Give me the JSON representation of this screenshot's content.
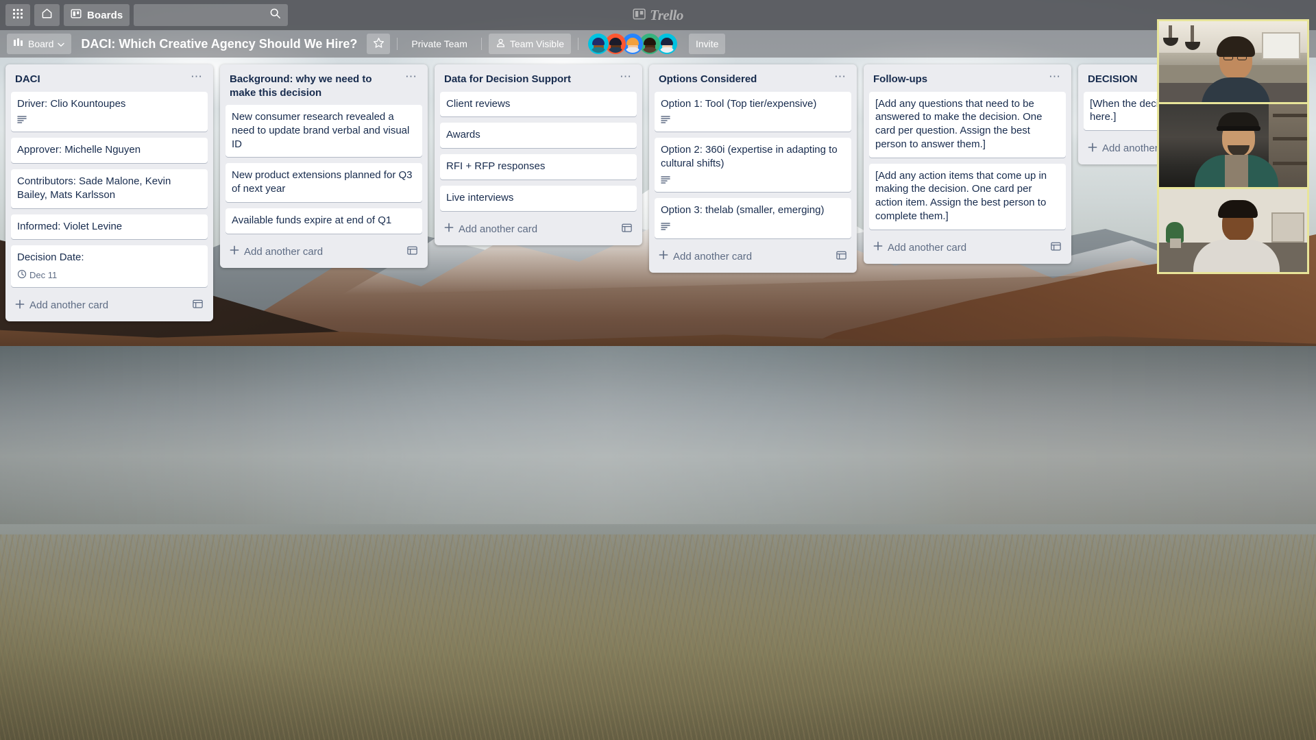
{
  "topbar": {
    "apps_icon": "grid-apps-icon",
    "home_icon": "home-icon",
    "boards_label": "Boards",
    "boards_icon": "board-icon",
    "search_placeholder": "",
    "search_value": "",
    "search_icon": "search-icon",
    "logo_text": "Trello"
  },
  "boardbar": {
    "board_button_label": "Board",
    "board_button_icon": "board-switch-icon",
    "chevron_icon": "chevron-down-icon",
    "title": "DACI: Which Creative Agency Should We Hire?",
    "star_icon": "star-icon",
    "team_label": "Private Team",
    "visibility_label": "Team Visible",
    "visibility_icon": "person-icon",
    "invite_label": "Invite",
    "members": [
      {
        "name": "member-1",
        "ring": "#00c2e0",
        "skin": "#8d5524",
        "hair": "#1f2b6b",
        "body": "#1f7a8c"
      },
      {
        "name": "member-2",
        "ring": "#ff5630",
        "skin": "#5a3318",
        "hair": "#1b1b2a",
        "body": "#243b53"
      },
      {
        "name": "member-3",
        "ring": "#2684ff",
        "skin": "#f3c9a0",
        "hair": "#f2a03d",
        "body": "#e8e8ec"
      },
      {
        "name": "member-4",
        "ring": "#36b37e",
        "skin": "#4b2a14",
        "hair": "#21150c",
        "body": "#5a4030"
      },
      {
        "name": "member-5",
        "ring": "#00c2e0",
        "skin": "#f0cdb0",
        "hair": "#1c2340",
        "body": "#eceff3"
      }
    ]
  },
  "lists": [
    {
      "title": "DACI",
      "menu_icon": "list-menu-icon",
      "add_card_label": "Add another card",
      "add_card_plus_icon": "plus-icon",
      "template_icon": "card-template-icon",
      "cards": [
        {
          "title": "Driver: Clio Kountoupes",
          "description_icon": "description-icon",
          "has_description": true
        },
        {
          "title": "Approver: Michelle Nguyen",
          "has_description": false
        },
        {
          "title": "Contributors: Sade Malone, Kevin Bailey, Mats Karlsson",
          "has_description": false
        },
        {
          "title": "Informed: Violet Levine",
          "has_description": false
        },
        {
          "title": "Decision Date:",
          "has_description": false,
          "due_badge": "Dec 11",
          "due_icon": "clock-icon"
        }
      ]
    },
    {
      "title": "Background: why we need to make this decision",
      "menu_icon": "list-menu-icon",
      "add_card_label": "Add another card",
      "add_card_plus_icon": "plus-icon",
      "template_icon": "card-template-icon",
      "cards": [
        {
          "title": "New consumer research revealed a need to update brand verbal and visual ID",
          "has_description": false
        },
        {
          "title": "New product extensions planned for Q3 of next year",
          "has_description": false
        },
        {
          "title": "Available funds expire at end of Q1",
          "has_description": false
        }
      ]
    },
    {
      "title": "Data for Decision Support",
      "menu_icon": "list-menu-icon",
      "add_card_label": "Add another card",
      "add_card_plus_icon": "plus-icon",
      "template_icon": "card-template-icon",
      "cards": [
        {
          "title": "Client reviews",
          "has_description": false
        },
        {
          "title": "Awards",
          "has_description": false
        },
        {
          "title": "RFI + RFP responses",
          "has_description": false
        },
        {
          "title": "Live interviews",
          "has_description": false
        }
      ]
    },
    {
      "title": "Options Considered",
      "menu_icon": "list-menu-icon",
      "add_card_label": "Add another card",
      "add_card_plus_icon": "plus-icon",
      "template_icon": "card-template-icon",
      "cards": [
        {
          "title": "Option 1: Tool (Top tier/expensive)",
          "description_icon": "description-icon",
          "has_description": true
        },
        {
          "title": "Option 2: 360i (expertise in adapting to cultural shifts)",
          "description_icon": "description-icon",
          "has_description": true
        },
        {
          "title": "Option 3: thelab (smaller, emerging)",
          "description_icon": "description-icon",
          "has_description": true
        }
      ]
    },
    {
      "title": "Follow-ups",
      "menu_icon": "list-menu-icon",
      "add_card_label": "Add another card",
      "add_card_plus_icon": "plus-icon",
      "template_icon": "card-template-icon",
      "cards": [
        {
          "title": "[Add any questions that need to be answered to make the decision. One card per question. Assign the best person to answer them.]",
          "has_description": false
        },
        {
          "title": "[Add any action items that come up in making the decision. One card per action item. Assign the best person to complete them.]",
          "has_description": false
        }
      ]
    },
    {
      "title": "DECISION",
      "menu_icon": "list-menu-icon",
      "add_card_label": "Add another card",
      "add_card_plus_icon": "plus-icon",
      "template_icon": "card-template-icon",
      "cards": [
        {
          "title": "[When the decision is made, record it here.]",
          "has_description": false
        }
      ]
    }
  ],
  "video_tiles": [
    {
      "name": "video-tile-1",
      "participant": "participant-top"
    },
    {
      "name": "video-tile-2",
      "participant": "participant-middle"
    },
    {
      "name": "video-tile-3",
      "participant": "participant-bottom"
    }
  ],
  "colors": {
    "list_bg": "#ebecf0",
    "card_bg": "#ffffff",
    "text_primary": "#172b4d",
    "text_muted": "#5e6c84",
    "video_border": "#e8e59a"
  }
}
